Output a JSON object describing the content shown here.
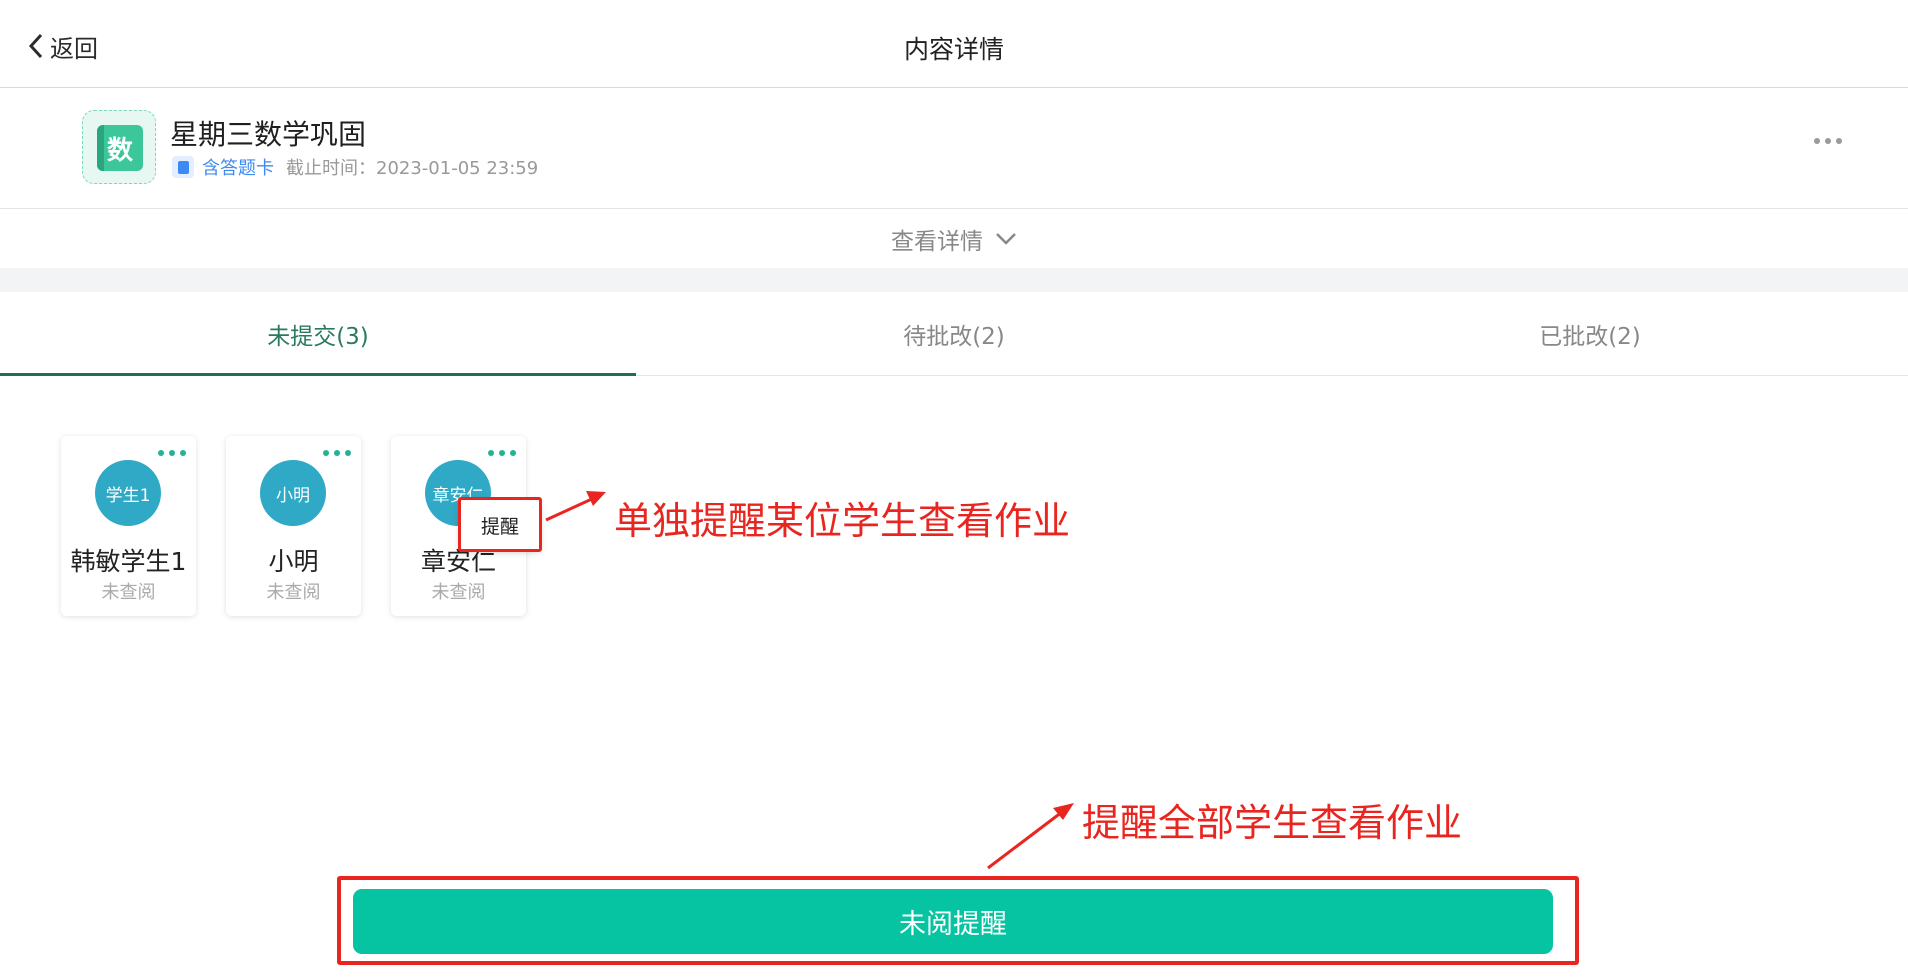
{
  "header": {
    "back_label": "返回",
    "title": "内容详情"
  },
  "homework": {
    "subject_char": "数",
    "title": "星期三数学巩固",
    "card_label": "含答题卡",
    "deadline": "截止时间：2023-01-05 23:59",
    "view_details": "查看详情"
  },
  "tabs": [
    {
      "label": "未提交(3)",
      "active": true
    },
    {
      "label": "待批改(2)",
      "active": false
    },
    {
      "label": "已批改(2)",
      "active": false
    }
  ],
  "students": [
    {
      "avatar": "学生1",
      "name": "韩敏学生1",
      "status": "未查阅"
    },
    {
      "avatar": "小明",
      "name": "小明",
      "status": "未查阅"
    },
    {
      "avatar": "章安仁",
      "name": "章安仁",
      "status": "未查阅"
    }
  ],
  "popup": {
    "remind_label": "提醒"
  },
  "annotations": {
    "single": "单独提醒某位学生查看作业",
    "all": "提醒全部学生查看作业"
  },
  "footer": {
    "remind_all_label": "未阅提醒"
  },
  "colors": {
    "accent": "#06c4a1",
    "tab_active": "#2a7a62",
    "annotation": "#e8261f",
    "avatar": "#2fa9c5"
  }
}
